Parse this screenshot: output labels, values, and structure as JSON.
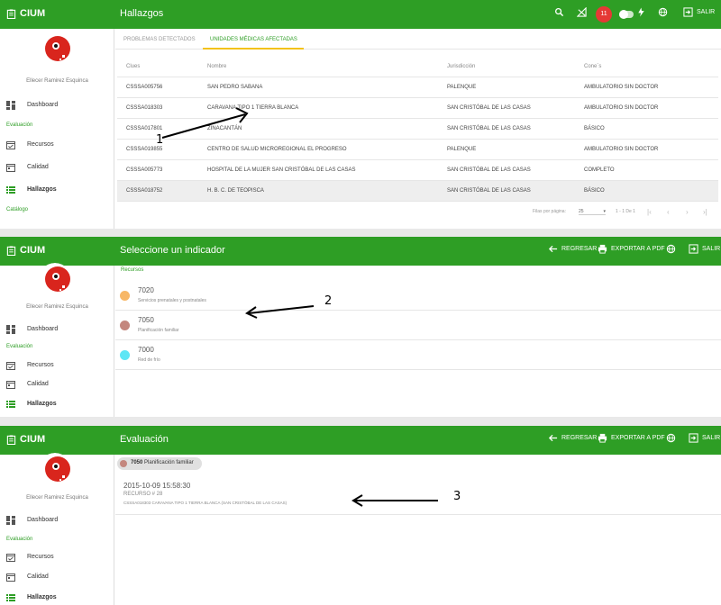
{
  "app": {
    "brand": "CIUM",
    "user_name": "Ellecer Ramirez Esquinca",
    "logout_label": "SALIR"
  },
  "sidebar": {
    "dashboard": "Dashboard",
    "section_evaluacion": "Evaluación",
    "recursos": "Recursos",
    "calidad": "Calidad",
    "hallazgos": "Hallazgos",
    "section_catalogo": "Catálogo"
  },
  "screen1": {
    "title": "Hallazgos",
    "notifications": "11",
    "tabs": [
      "PROBLEMAS DETECTADOS",
      "UNIDADES MÉDICAS AFECTADAS"
    ],
    "columns": [
      "Clues",
      "Nombre",
      "Jurisdicción",
      "Cone´s"
    ],
    "rows": [
      [
        "CSSSA005756",
        "SAN PEDRO SABANA",
        "PALENQUE",
        "AMBULATORIO SIN DOCTOR"
      ],
      [
        "CSSSA018303",
        "CARAVANA TIPO 1 TIERRA BLANCA",
        "SAN CRISTÓBAL DE LAS CASAS",
        "AMBULATORIO SIN DOCTOR"
      ],
      [
        "CSSSA017801",
        "ZINACANTÁN",
        "SAN CRISTÓBAL DE LAS CASAS",
        "BÁSICO"
      ],
      [
        "CSSSA019855",
        "CENTRO DE SALUD MICROREGIONAL EL PROGRESO",
        "PALENQUE",
        "AMBULATORIO SIN DOCTOR"
      ],
      [
        "CSSSA005773",
        "HOSPITAL DE LA MUJER SAN CRISTÓBAL DE LAS CASAS",
        "SAN CRISTÓBAL DE LAS CASAS",
        "COMPLETO"
      ],
      [
        "CSSSA018752",
        "H. B. C. DE TEOPISCA",
        "SAN CRISTÓBAL DE LAS CASAS",
        "BÁSICO"
      ]
    ],
    "pager": {
      "rows_label": "Filas por página:",
      "rows_value": "25",
      "range": "1 - 1 De 1"
    }
  },
  "screen2": {
    "title": "Seleccione un indicador",
    "back_label": "REGRESAR",
    "export_label": "EXPORTAR A PDF",
    "section": "Recursos",
    "indicators": [
      {
        "code": "7020",
        "name": "Servicios prenatales y postnatales",
        "color": "#f7b766"
      },
      {
        "code": "7050",
        "name": "Planificación familiar",
        "color": "#c4877e"
      },
      {
        "code": "7000",
        "name": "Red de frío",
        "color": "#5ee6f5"
      }
    ]
  },
  "screen3": {
    "title": "Evaluación",
    "back_label": "REGRESAR",
    "export_label": "EXPORTAR A PDF",
    "chip_code": "7050",
    "chip_name": "Planificación familiar",
    "entry": {
      "date": "2015-10-09 15:58:30",
      "record": "RECURSO # 28",
      "desc": "CSSSA018303 CARAVANA TIPO 1 TIERRA BLANCA (SAN CRISTÓBAL DE LAS CASAS)"
    }
  },
  "annotations": [
    "1",
    "2",
    "3"
  ],
  "colors": {
    "primary": "#2e9e25",
    "accent": "#f3c21a",
    "badge": "#e53935"
  }
}
